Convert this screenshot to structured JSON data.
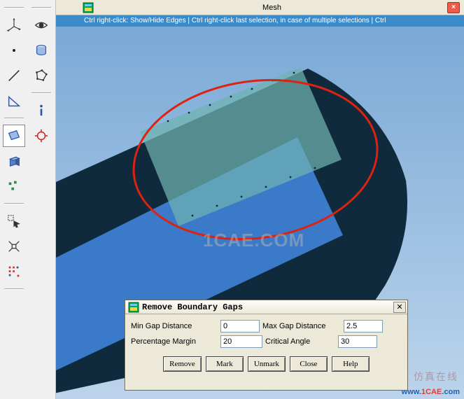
{
  "window": {
    "title": "Mesh"
  },
  "hint": "Ctrl right-click: Show/Hide Edges | Ctrl right-click last selection, in case of multiple selections | Ctrl",
  "watermark": {
    "big": "1CAE.COM",
    "small_a": "www.",
    "small_b": "1CAE",
    "small_c": ".com",
    "cn": "仿真在线"
  },
  "dialog": {
    "title": "Remove Boundary Gaps",
    "fields": {
      "min_gap_label": "Min Gap Distance",
      "min_gap_value": "0",
      "max_gap_label": "Max Gap Distance",
      "max_gap_value": "2.5",
      "pct_margin_label": "Percentage Margin",
      "pct_margin_value": "20",
      "crit_angle_label": "Critical Angle",
      "crit_angle_value": "30"
    },
    "buttons": {
      "remove": "Remove",
      "mark": "Mark",
      "unmark": "Unmark",
      "close": "Close",
      "help": "Help"
    }
  }
}
